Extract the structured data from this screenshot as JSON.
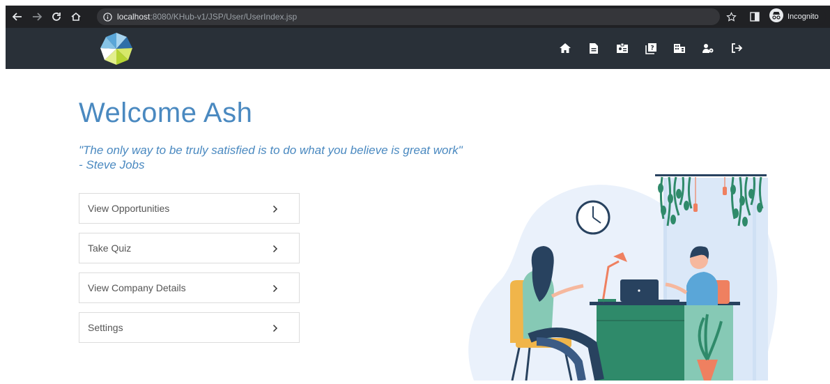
{
  "browser": {
    "url_host": "localhost",
    "url_path": ":8080/KHub-v1/JSP/User/UserIndex.jsp",
    "incognito_label": "Incognito",
    "icons": [
      "back-arrow-icon",
      "forward-arrow-icon",
      "reload-icon",
      "home-icon",
      "info-icon",
      "star-icon",
      "side-panel-icon",
      "incognito-icon"
    ]
  },
  "header": {
    "background": "#293038",
    "nav_icons": [
      "home-icon",
      "document-icon",
      "id-badge-icon",
      "quiz-book-icon",
      "building-icon",
      "user-gear-icon",
      "logout-icon"
    ]
  },
  "main": {
    "welcome_text": "Welcome Ash",
    "quote_line1": "\"The only way to be truly satisfied is to do what you believe is great work\"",
    "quote_line2": "- Steve Jobs",
    "menu": [
      {
        "label": "View Opportunities"
      },
      {
        "label": "Take Quiz"
      },
      {
        "label": "View Company Details"
      },
      {
        "label": "Settings"
      }
    ]
  },
  "colors": {
    "accent": "#4a89c0",
    "header": "#293038",
    "chrome": "#202124"
  }
}
